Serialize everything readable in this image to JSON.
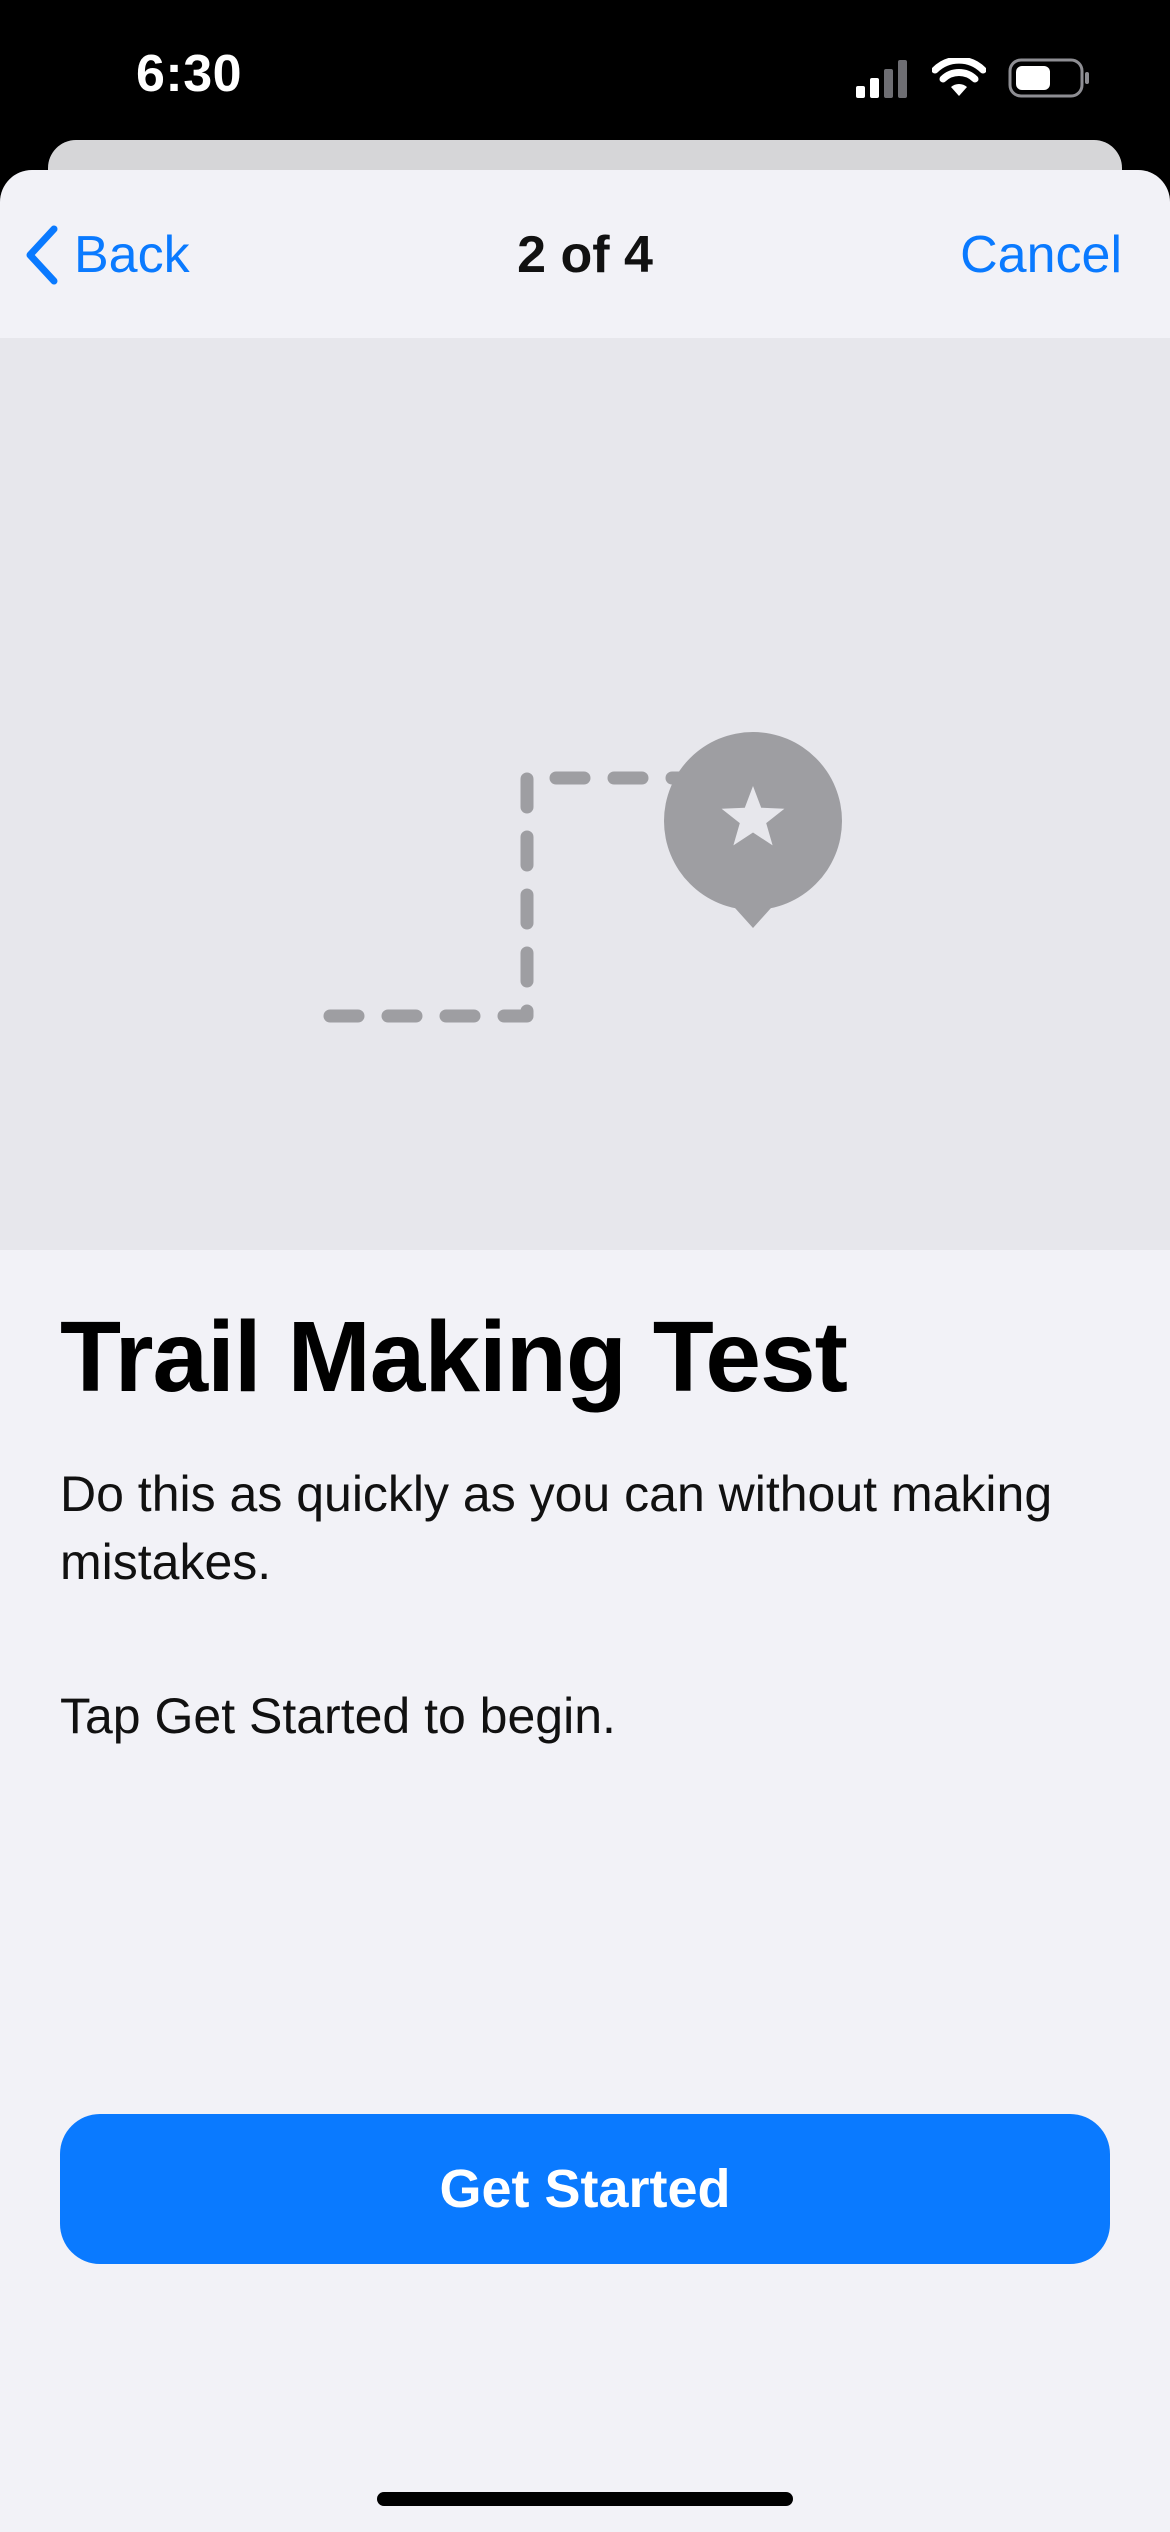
{
  "status_bar": {
    "time": "6:30",
    "icons": [
      "cellular-signal-icon",
      "wifi-icon",
      "battery-icon"
    ]
  },
  "nav": {
    "back_label": "Back",
    "step_label": "2 of 4",
    "cancel_label": "Cancel"
  },
  "hero": {
    "icons": [
      "star-map-pin-icon",
      "dashed-trail-path"
    ]
  },
  "content": {
    "title": "Trail Making Test",
    "description": "Do this as quickly as you can without making mistakes.",
    "instruction": "Tap Get Started to begin."
  },
  "actions": {
    "primary_label": "Get Started"
  },
  "colors": {
    "accent": "#0a7aff",
    "background": "#f2f2f7",
    "hero_background": "#e7e7ec",
    "illustration_gray": "#9e9ea2"
  }
}
